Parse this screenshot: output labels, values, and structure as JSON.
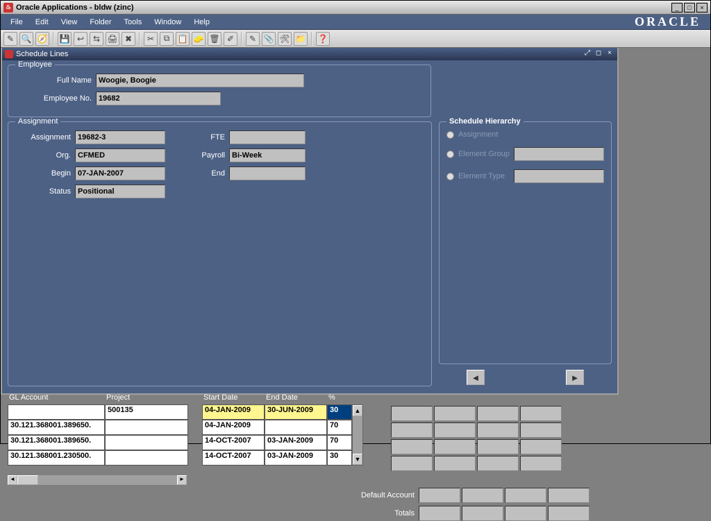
{
  "window": {
    "title": "Oracle Applications - bldw (zinc)",
    "brand": "ORACLE"
  },
  "menus": [
    "File",
    "Edit",
    "View",
    "Folder",
    "Tools",
    "Window",
    "Help"
  ],
  "subwindow": {
    "title": "Schedule Lines"
  },
  "employee": {
    "legend": "Employee",
    "full_name_label": "Full Name",
    "full_name": "Woogie, Boogie",
    "emp_no_label": "Employee No.",
    "emp_no": "19682"
  },
  "assignment": {
    "legend": "Assignment",
    "assignment_label": "Assignment",
    "assignment": "19682-3",
    "org_label": "Org.",
    "org": "CFMED",
    "begin_label": "Begin",
    "begin": "07-JAN-2007",
    "status_label": "Status",
    "status": "Positional",
    "fte_label": "FTE",
    "fte": "",
    "payroll_label": "Payroll",
    "payroll": "Bi-Week",
    "end_label": "End",
    "end": ""
  },
  "hierarchy": {
    "legend": "Schedule Hierarchy",
    "opt_assignment": "Assignment",
    "opt_elem_group": "Element Group",
    "opt_elem_type": "Element Type"
  },
  "columns": {
    "gl_account": "GL Account",
    "project": "Project",
    "start_date": "Start Date",
    "end_date": "End Date",
    "pct": "%"
  },
  "rows": [
    {
      "gl": "",
      "project": "500135",
      "start": "04-JAN-2009",
      "end": "30-JUN-2009",
      "pct": "30",
      "hl": true
    },
    {
      "gl": "30.121.368001.389650.",
      "project": "",
      "start": "04-JAN-2009",
      "end": "",
      "pct": "70"
    },
    {
      "gl": "30.121.368001.389650.",
      "project": "",
      "start": "14-OCT-2007",
      "end": "03-JAN-2009",
      "pct": "70"
    },
    {
      "gl": "30.121.368001.230500.",
      "project": "",
      "start": "14-OCT-2007",
      "end": "03-JAN-2009",
      "pct": "30"
    }
  ],
  "labels": {
    "default_account": "Default Account",
    "totals": "Totals"
  }
}
